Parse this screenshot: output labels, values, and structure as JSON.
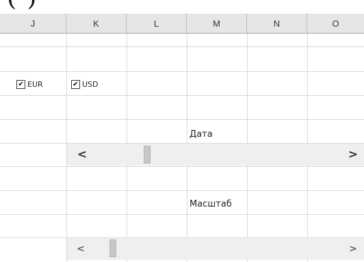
{
  "page_heading_fragment": "(   )",
  "columns": [
    "J",
    "K",
    "L",
    "M",
    "N",
    "O"
  ],
  "checkboxes": [
    {
      "label": "EUR",
      "checked": true
    },
    {
      "label": "USD",
      "checked": true
    }
  ],
  "labels": {
    "date": "Дата",
    "scale": "Масштаб"
  },
  "scrollbars": {
    "date": {
      "left_arrow": "<",
      "right_arrow": ">",
      "position": 0.3
    },
    "scale": {
      "left_arrow": "<",
      "right_arrow": ">",
      "position": 0.1
    }
  },
  "icons": {
    "checkmark": "check-icon",
    "arrow_left": "chevron-left-icon",
    "arrow_right": "chevron-right-icon"
  },
  "colors": {
    "header_bg": "#e6e6e6",
    "gridline": "#d9d9d9",
    "scrollbar_bg": "#efefef",
    "scrollbar_thumb": "#c8c8c8"
  }
}
